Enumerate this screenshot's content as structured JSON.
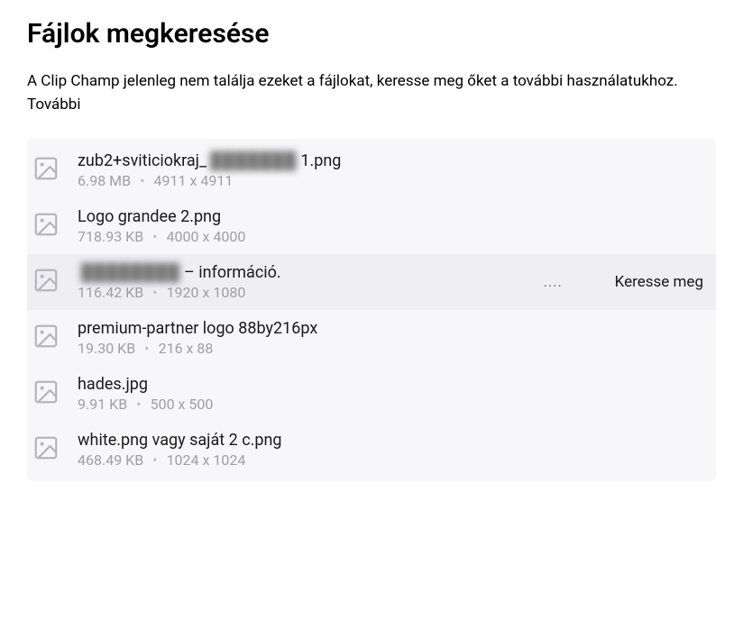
{
  "heading": "Fájlok megkeresése",
  "description": "A Clip Champ jelenleg nem találja ezeket a fájlokat, keresse meg őket a további használatukhoz. További",
  "icons": {
    "image": "image-icon",
    "more": "...."
  },
  "actions": {
    "locate": "Keresse meg"
  },
  "files": [
    {
      "name_prefix": "zub2+sviticiokraj_",
      "name_blur": "███████",
      "name_suffix": " 1.png",
      "size": "6.98 MB",
      "dims": "4911 x 4911",
      "highlighted": false,
      "show_actions": false
    },
    {
      "name_prefix": "Logo grandee 2.png",
      "name_blur": "",
      "name_suffix": "",
      "size": "718.93 KB",
      "dims": "4000 x 4000",
      "highlighted": false,
      "show_actions": false
    },
    {
      "name_prefix": "",
      "name_blur": "████████",
      "name_suffix": " – információ.",
      "size": "116.42 KB",
      "dims": "1920 x 1080",
      "highlighted": true,
      "show_actions": true
    },
    {
      "name_prefix": "premium-partner logo 88by216px",
      "name_blur": "",
      "name_suffix": "",
      "size": "19.30 KB",
      "dims": "216 x 88",
      "highlighted": false,
      "show_actions": false
    },
    {
      "name_prefix": "hades.jpg",
      "name_blur": "",
      "name_suffix": "",
      "size": "9.91 KB",
      "dims": "500 x 500",
      "highlighted": false,
      "show_actions": false
    },
    {
      "name_prefix": "white.png vagy saját 2 c.png",
      "name_blur": "",
      "name_suffix": "",
      "size": "468.49 KB",
      "dims": "1024 x 1024",
      "highlighted": false,
      "show_actions": false
    }
  ]
}
